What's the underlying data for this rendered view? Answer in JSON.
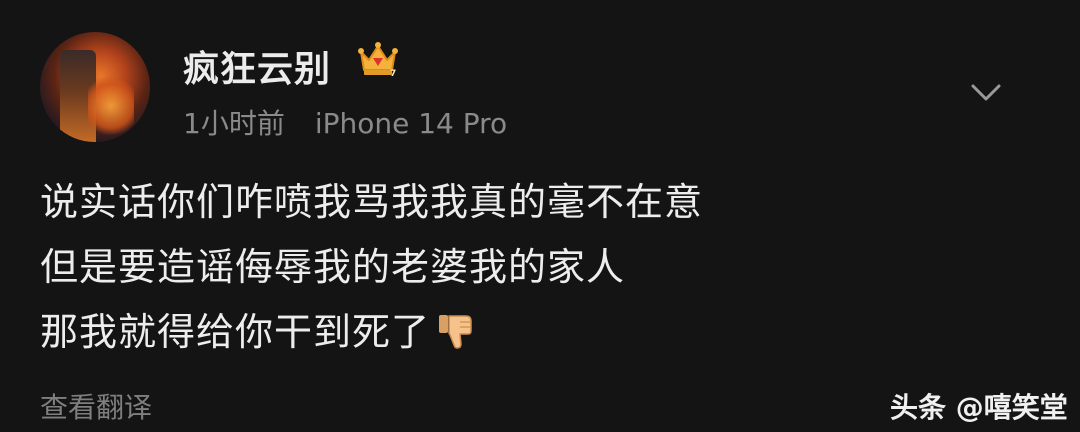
{
  "post": {
    "username": "疯狂云别",
    "badge_icon": "crown-badge-icon",
    "time": "1小时前",
    "device": "iPhone 14 Pro",
    "menu_icon": "chevron-down-icon",
    "lines": [
      "说实话你们咋喷我骂我我真的毫不在意",
      "但是要造谣侮辱我的老婆我的家人",
      "那我就得给你干到死了"
    ],
    "trailing_emoji_icon": "thumbs-down-icon",
    "translate_label": "查看翻译"
  },
  "watermark": "头条 @嘻笑堂",
  "colors": {
    "background": "#141414",
    "text": "#ededed",
    "secondary": "#8a8a8a",
    "crown": "#f0a830"
  }
}
